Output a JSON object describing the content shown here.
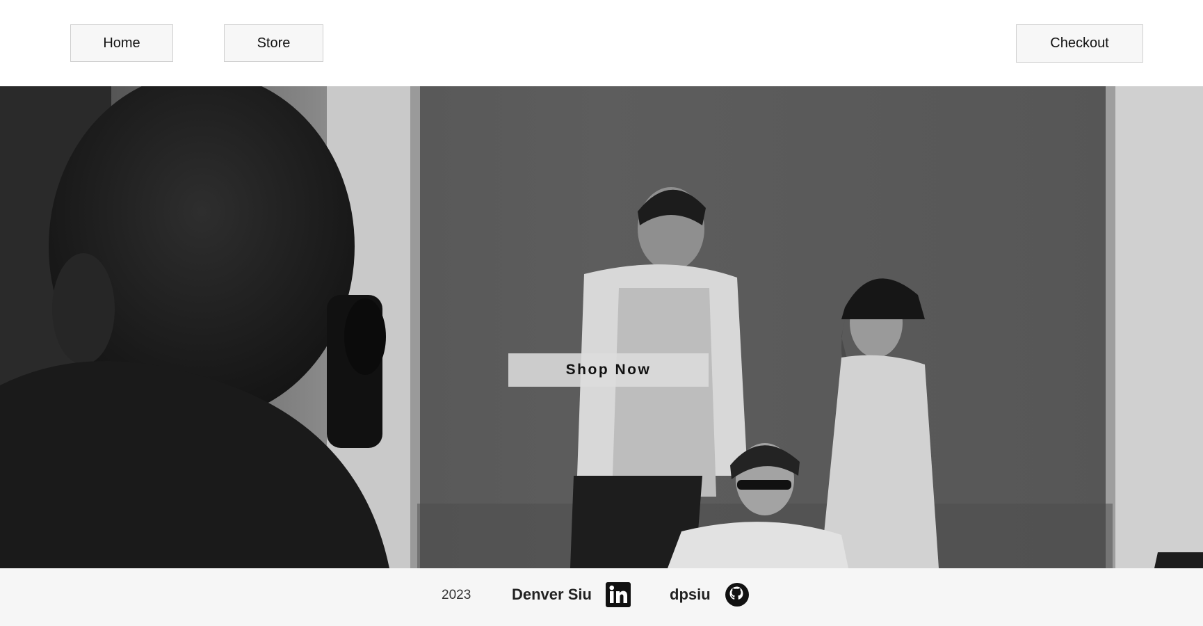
{
  "nav": {
    "home_label": "Home",
    "store_label": "Store",
    "checkout_label": "Checkout"
  },
  "hero": {
    "cta_label": "Shop Now",
    "image_description_icon": "photo-shoot-image"
  },
  "footer": {
    "year": "2023",
    "author": "Denver Siu",
    "handle": "dpsiu",
    "linkedin_icon": "linkedin-icon",
    "github_icon": "github-icon"
  },
  "colors": {
    "background": "#ffffff",
    "footer_background": "#f6f6f6",
    "button_background": "#f7f7f7",
    "button_border": "#cfcfcf"
  }
}
